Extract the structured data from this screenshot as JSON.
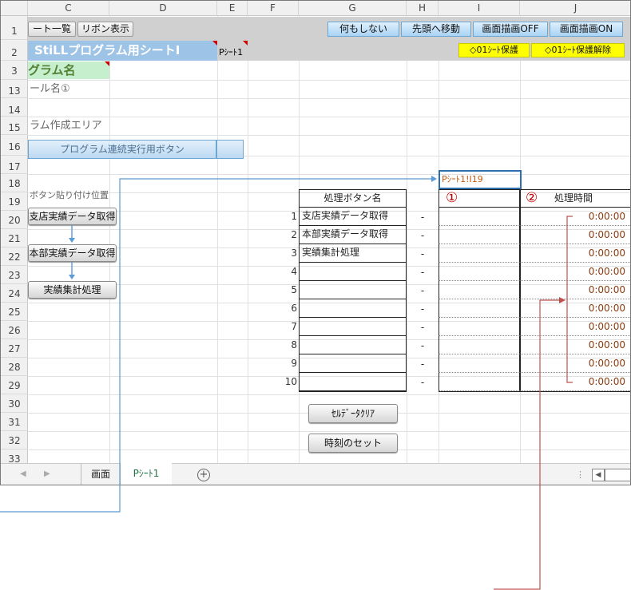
{
  "columns": [
    "C",
    "D",
    "E",
    "F",
    "G",
    "H",
    "I",
    "J"
  ],
  "rows": [
    "1",
    "2",
    "3",
    "13",
    "14",
    "15",
    "16",
    "17",
    "18",
    "19",
    "20",
    "21",
    "22",
    "23",
    "24",
    "25",
    "26",
    "27",
    "28",
    "29",
    "30",
    "31",
    "32",
    "33"
  ],
  "top_buttons": {
    "sheet_list": "ート一覧",
    "ribbon": "リボン表示",
    "do_nothing": "何もしない",
    "go_top": "先頭へ移動",
    "draw_off": "画面描画OFF",
    "draw_on": "画面描画ON",
    "protect": "◇01ｼｰﾄ保護",
    "unprotect": "◇01ｼｰﾄ保護解除"
  },
  "banner": {
    "title": "StiLLプログラム用シートⅠ",
    "sheet_label": "Pｼｰﾄ1"
  },
  "program_name": "グラム名",
  "tool_name": "ール名①",
  "program_area": "ラム作成エリア",
  "run_button": "プログラム連続実行用ボタン",
  "paste_area": "ボタン貼り付け位置",
  "flow_buttons": [
    "支店実績データ取得",
    "本部実績データ取得",
    "実績集計処理"
  ],
  "ref_cell": "Pｼｰﾄ1!I19",
  "table": {
    "header_name": "処理ボタン名",
    "header_time": "処理時間",
    "circle1": "①",
    "circle2": "②",
    "numbers": [
      "1",
      "2",
      "3",
      "4",
      "5",
      "6",
      "7",
      "8",
      "9",
      "10"
    ],
    "names": [
      "支店実績データ取得",
      "本部実績データ取得",
      "実績集計処理",
      "",
      "",
      "",
      "",
      "",
      "",
      ""
    ],
    "dash": "-",
    "times": [
      "0:00:00",
      "0:00:00",
      "0:00:00",
      "0:00:00",
      "0:00:00",
      "0:00:00",
      "0:00:00",
      "0:00:00",
      "0:00:00",
      "0:00:00"
    ]
  },
  "action_buttons": {
    "clear": "ｾﾙﾃﾞｰﾀｸﾘｱ",
    "set_time": "時刻のセット"
  },
  "tabs": [
    "画面",
    "Pｼｰﾄ1"
  ],
  "colors": {
    "accent_blue": "#5b9bd5",
    "time_red": "#c0504d",
    "banner_blue": "#9dc3e6",
    "green": "#c6efce"
  }
}
